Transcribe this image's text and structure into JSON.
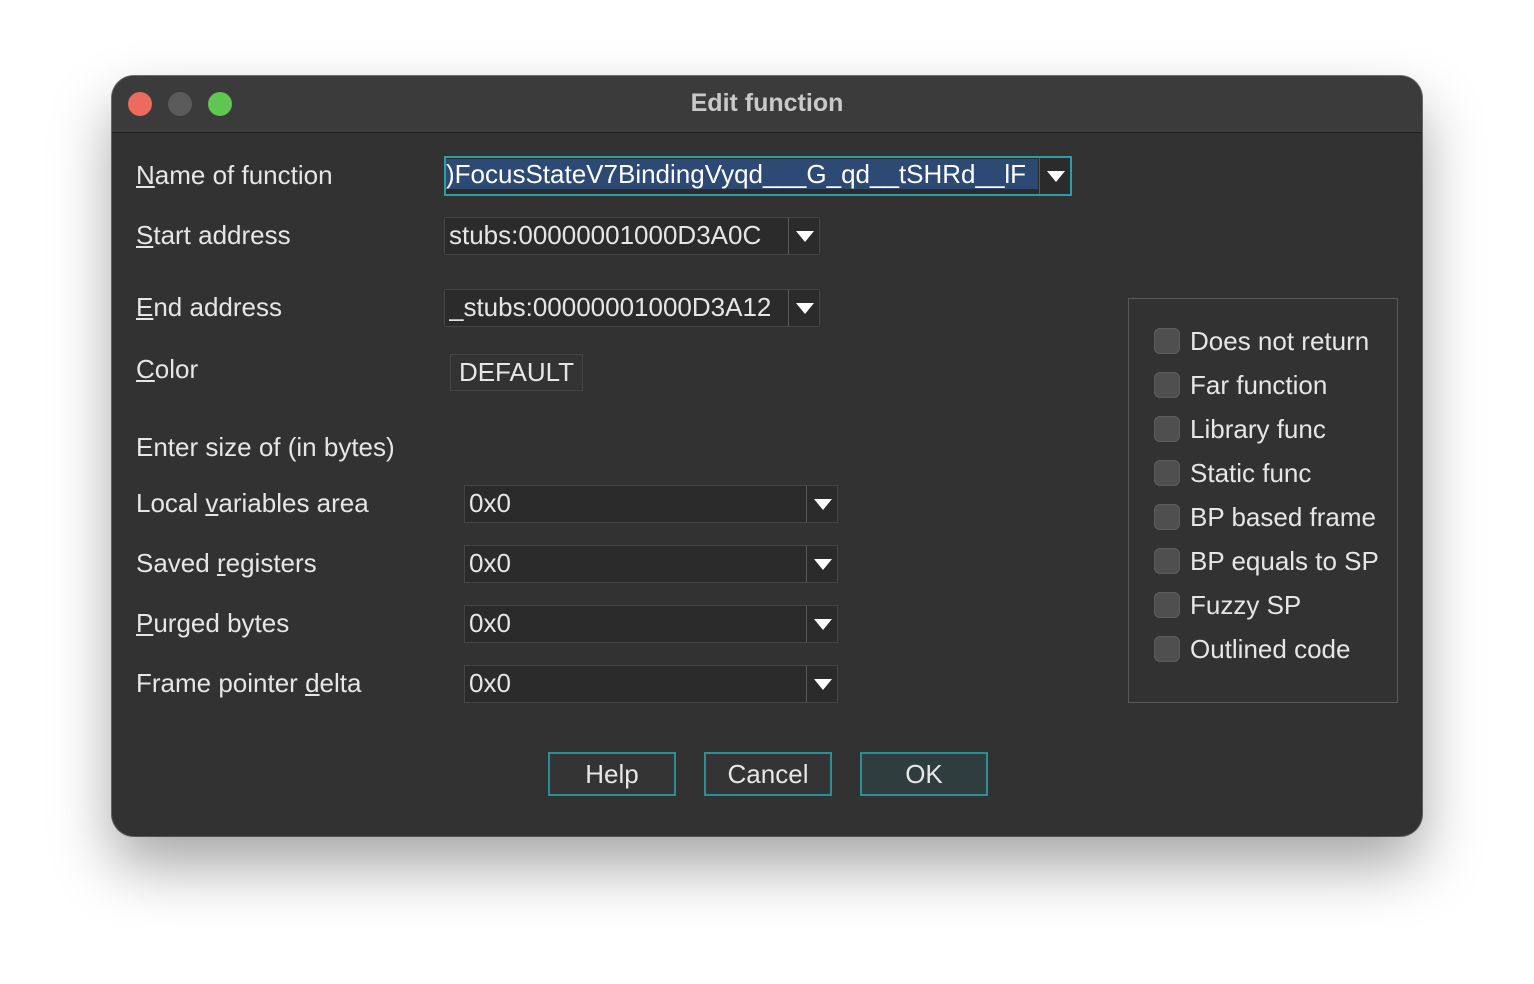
{
  "window": {
    "title": "Edit function"
  },
  "fields": {
    "name_label_pre": "",
    "name_label_u": "N",
    "name_label_post": "ame of function",
    "name_value": ")FocusStateV7BindingVyqd___G_qd__tSHRd__lF",
    "start_label_u": "S",
    "start_label_post": "tart address",
    "start_value": "stubs:00000001000D3A0C",
    "end_label_u": "E",
    "end_label_post": "nd address",
    "end_value": "_stubs:00000001000D3A12",
    "color_label_u": "C",
    "color_label_post": "olor",
    "color_value": "DEFAULT"
  },
  "sizes": {
    "heading": "Enter size of (in bytes)",
    "local_pre": "Local ",
    "local_u": "v",
    "local_post": "ariables area",
    "local_value": "0x0",
    "saved_pre": "Saved ",
    "saved_u": "r",
    "saved_post": "egisters",
    "saved_value": "0x0",
    "purged_u": "P",
    "purged_post": "urged bytes",
    "purged_value": "0x0",
    "frame_pre": "Frame pointer ",
    "frame_u": "d",
    "frame_post": "elta",
    "frame_value": "0x0"
  },
  "flags": [
    {
      "label": "Does not return",
      "checked": false
    },
    {
      "label": "Far function",
      "checked": false
    },
    {
      "label": "Library func",
      "checked": false
    },
    {
      "label": "Static func",
      "checked": false
    },
    {
      "label": "BP based frame",
      "checked": false
    },
    {
      "label": "BP equals to SP",
      "checked": false
    },
    {
      "label": "Fuzzy SP",
      "checked": false
    },
    {
      "label": "Outlined code",
      "checked": false
    }
  ],
  "buttons": {
    "help": "Help",
    "cancel": "Cancel",
    "ok": "OK"
  },
  "colors": {
    "window_bg": "#323232",
    "accent": "#2d9ea5",
    "selection": "#2d4a75"
  }
}
